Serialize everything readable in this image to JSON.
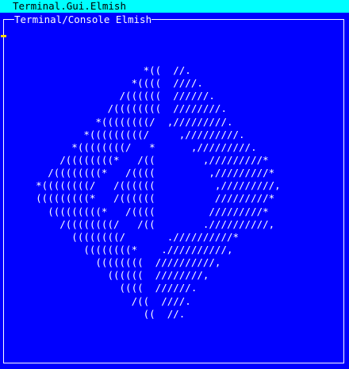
{
  "menubar": {
    "title": "Terminal.Gui.Elmish"
  },
  "window": {
    "title": "Terminal/Console Elmish"
  },
  "logo": {
    "lines": [
      "                        *((  //.",
      "                      *((((  ////.",
      "                    /((((((  //////.",
      "                  /((((((((  ////////.",
      "                *((((((((/  ,/////////.",
      "              *(((((((((/     ,/////////.",
      "            *((((((((/   *      ,/////////.",
      "          /((((((((*   /((        ,/////////*",
      "        /((((((((*   /((((         ,/////////*",
      "      *((((((((/   /((((((          ,/////////,",
      "      (((((((((*   /((((((          /////////*",
      "        (((((((((*   /((((         /////////*",
      "          /((((((((/   /((        .//////////,",
      "            ((((((((/       .//////////*",
      "              ((((((((*    .//////////,",
      "                ((((((((  //////////,",
      "                  ((((((  ////////,",
      "                    ((((  //////.",
      "                      /((  ////.",
      "                        ((  //."
    ]
  },
  "colors": {
    "background": "#0000ff",
    "menubar_bg": "#00ffff",
    "menubar_fg": "#000000",
    "text": "#ffffff",
    "cursor": "#ffd700"
  }
}
